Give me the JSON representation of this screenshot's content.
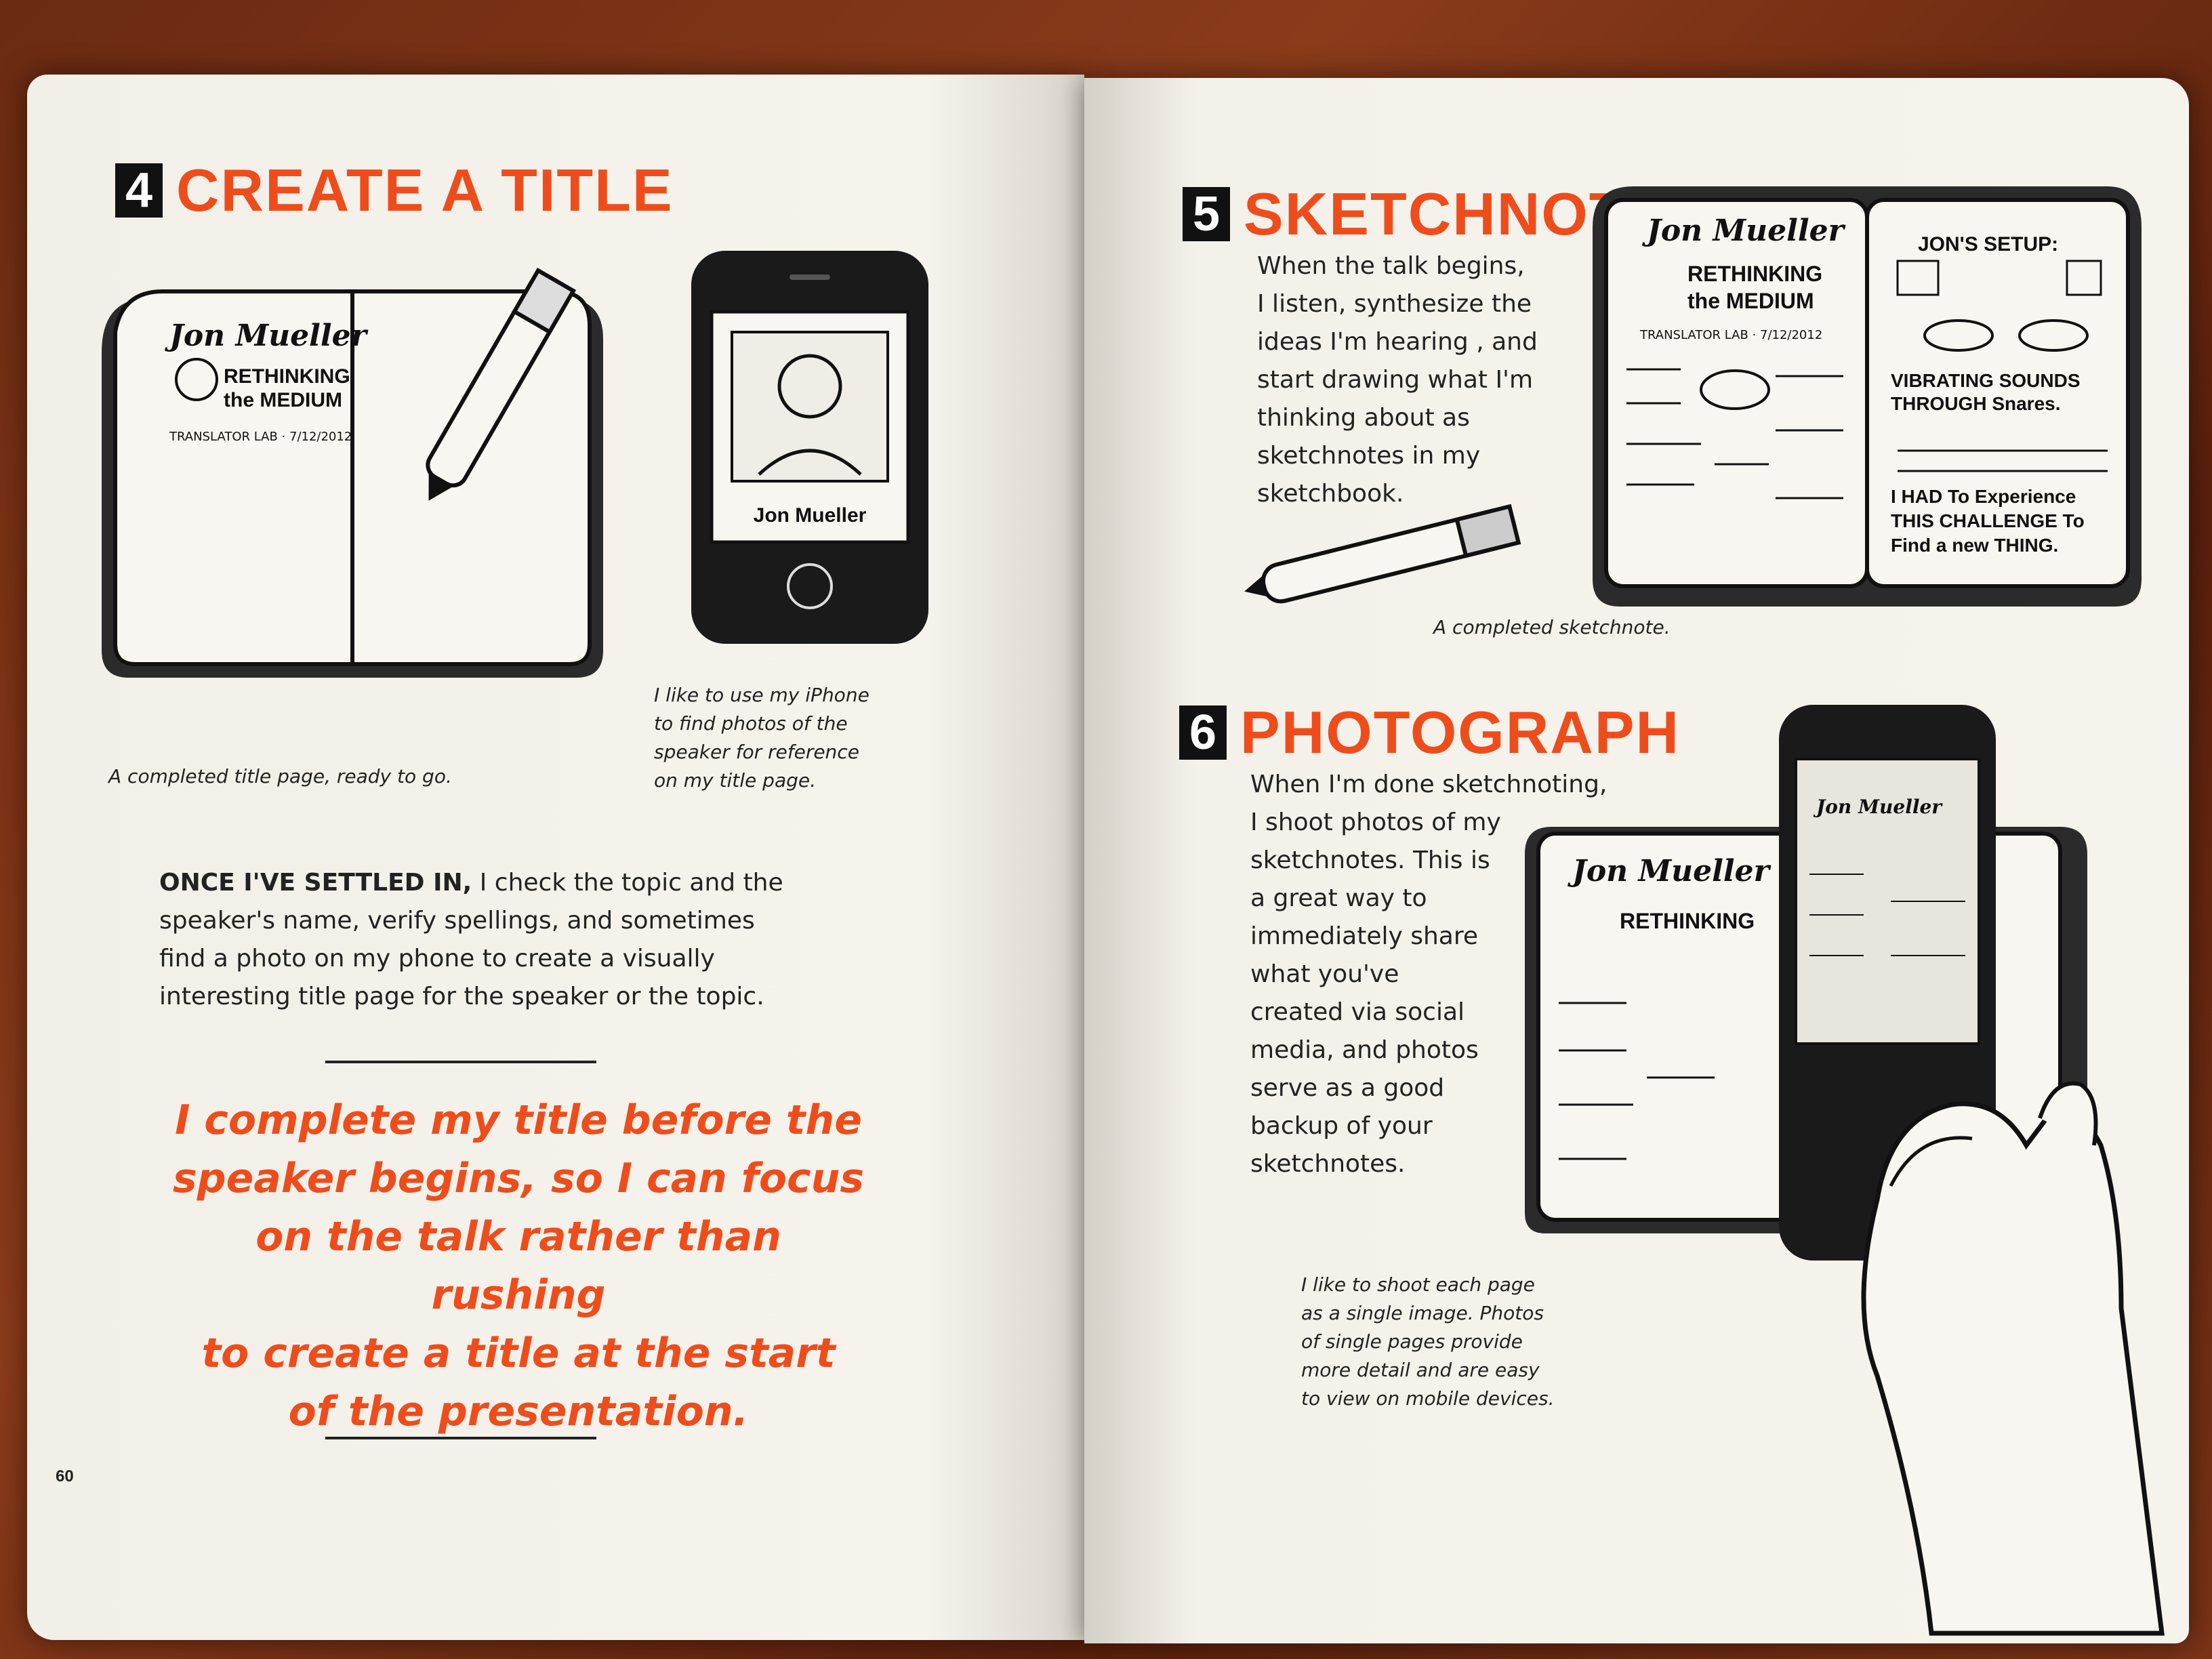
{
  "left": {
    "step4": {
      "number": "4",
      "title": "CREATE A TITLE"
    },
    "sketch_notebook": {
      "name": "Jon Mueller",
      "line1": "RETHINKING",
      "line2": "the MEDIUM",
      "footer": "TRANSLATOR LAB · 7/12/2012"
    },
    "phone_name": "Jon Mueller",
    "caption_title_page": "A completed title page, ready to go.",
    "caption_iphone": "I like to use my iPhone\nto find photos of the\nspeaker for reference\non my title page.",
    "paragraph_lead": "ONCE I'VE SETTLED IN,",
    "paragraph_rest": " I check the topic and the\nspeaker's name, verify spellings, and sometimes\nfind a photo on my phone to create a visually\ninteresting title page for the speaker or the topic.",
    "quote": "I complete my title before the\nspeaker begins, so I can focus\non the talk rather than rushing\nto create a title at the start\nof the presentation.",
    "page_number": "60"
  },
  "right": {
    "step5": {
      "number": "5",
      "title": "SKETCHNOTE"
    },
    "step5_text": "When the talk begins,\nI listen, synthesize the\nideas I'm hearing , and\nstart drawing what I'm\nthinking about as\nsketchnotes in my\nsketchbook.",
    "caption_sketchnote": "A completed sketchnote.",
    "notebook_right_title": "JON'S SETUP:",
    "notebook_right_mid": "VIBRATING SOUNDS THROUGH Snares.",
    "notebook_right_bottom": "I HAD To Experience THIS CHALLENGE To Find a new THING.",
    "step6": {
      "number": "6",
      "title": "PHOTOGRAPH"
    },
    "step6_text": "When I'm done sketchnoting,\nI shoot photos of my\nsketchnotes. This is\na great way to\nimmediately share\nwhat you've\ncreated via social\nmedia, and photos\nserve as a good\nbackup of your\nsketchnotes.",
    "caption_photo": "I like to shoot each page\nas a single image. Photos\nof single pages provide\nmore detail and are easy\nto view on mobile devices."
  },
  "colors": {
    "accent": "#ee4d1b",
    "ink": "#222222",
    "paper": "#f4f1ea"
  }
}
